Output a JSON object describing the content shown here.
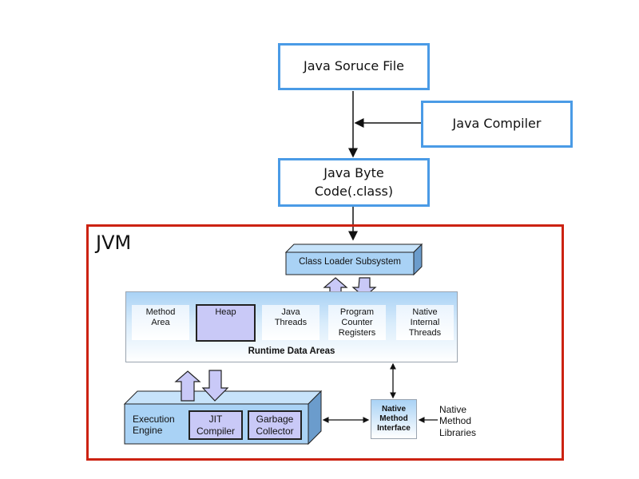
{
  "flow": {
    "source_file": "Java Soruce File",
    "compiler": "Java Compiler",
    "bytecode_line1": "Java Byte",
    "bytecode_line2": "Code(.class)"
  },
  "jvm": {
    "label": "JVM",
    "class_loader": "Class Loader Subsystem",
    "runtime_data_areas": {
      "title": "Runtime Data Areas",
      "cells": [
        {
          "line1": "Method",
          "line2": "Area",
          "line3": ""
        },
        {
          "line1": "Heap",
          "line2": "",
          "line3": ""
        },
        {
          "line1": "Java",
          "line2": "Threads",
          "line3": ""
        },
        {
          "line1": "Program",
          "line2": "Counter",
          "line3": "Registers"
        },
        {
          "line1": "Native",
          "line2": "Internal",
          "line3": "Threads"
        }
      ]
    },
    "execution_engine": {
      "line1": "Execution",
      "line2": "Engine",
      "jit_line1": "JIT",
      "jit_line2": "Compiler",
      "gc_line1": "Garbage",
      "gc_line2": "Collector"
    },
    "native_method_interface": {
      "line1": "Native",
      "line2": "Method",
      "line3": "Interface"
    },
    "native_method_libraries": {
      "line1": "Native",
      "line2": "Method",
      "line3": "Libraries"
    }
  },
  "colors": {
    "flow_border": "#4a9be6",
    "jvm_border": "#cc2211",
    "block_blue": "#a9d2f5",
    "block_lavender": "#c9c9f7"
  }
}
